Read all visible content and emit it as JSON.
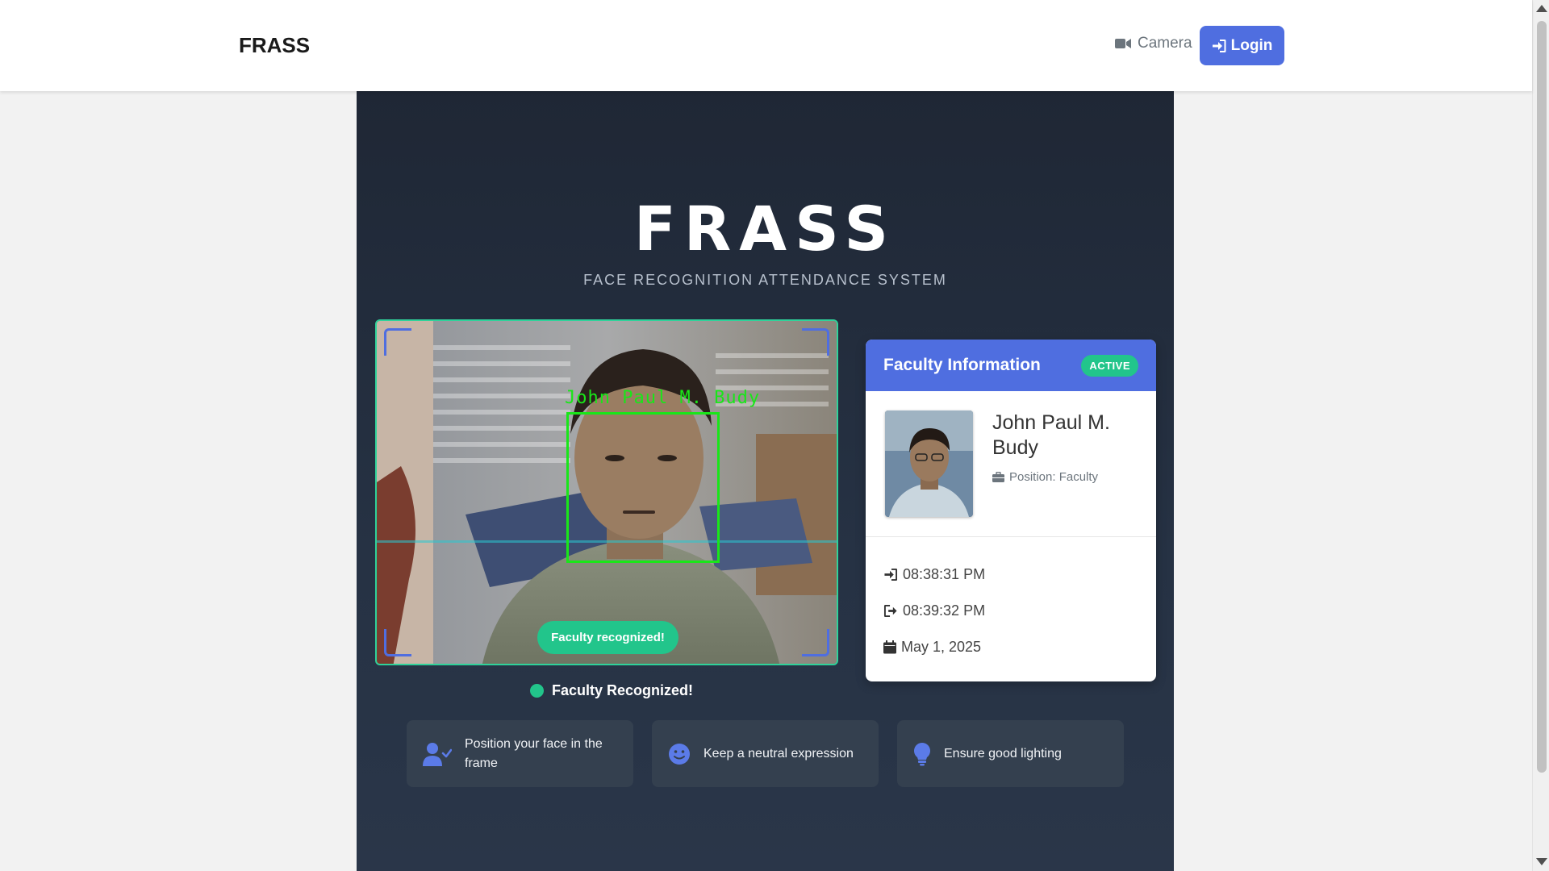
{
  "navbar": {
    "brand": "FRASS",
    "camera_label": "Camera",
    "login_label": "Login"
  },
  "hero": {
    "title": "FRASS",
    "subtitle": "FACE RECOGNITION ATTENDANCE SYSTEM"
  },
  "camera": {
    "detected_name": "John Paul M. Budy",
    "toast": "Faculty recognized!",
    "status": "Faculty Recognized!"
  },
  "card": {
    "title": "Faculty Information",
    "badge": "ACTIVE",
    "name": "John Paul M. Budy",
    "position": "Position: Faculty",
    "time_in": "08:38:31 PM",
    "time_out": "08:39:32 PM",
    "date": "May 1, 2025"
  },
  "tips": [
    {
      "text": "Position your face in the frame",
      "icon": "user-check-icon"
    },
    {
      "text": "Keep a neutral expression",
      "icon": "smile-icon"
    },
    {
      "text": "Ensure good lighting",
      "icon": "lightbulb-icon"
    }
  ],
  "colors": {
    "accent": "#4f6ee0",
    "success": "#22c58b",
    "detection": "#19e619",
    "panel": "#263244"
  }
}
